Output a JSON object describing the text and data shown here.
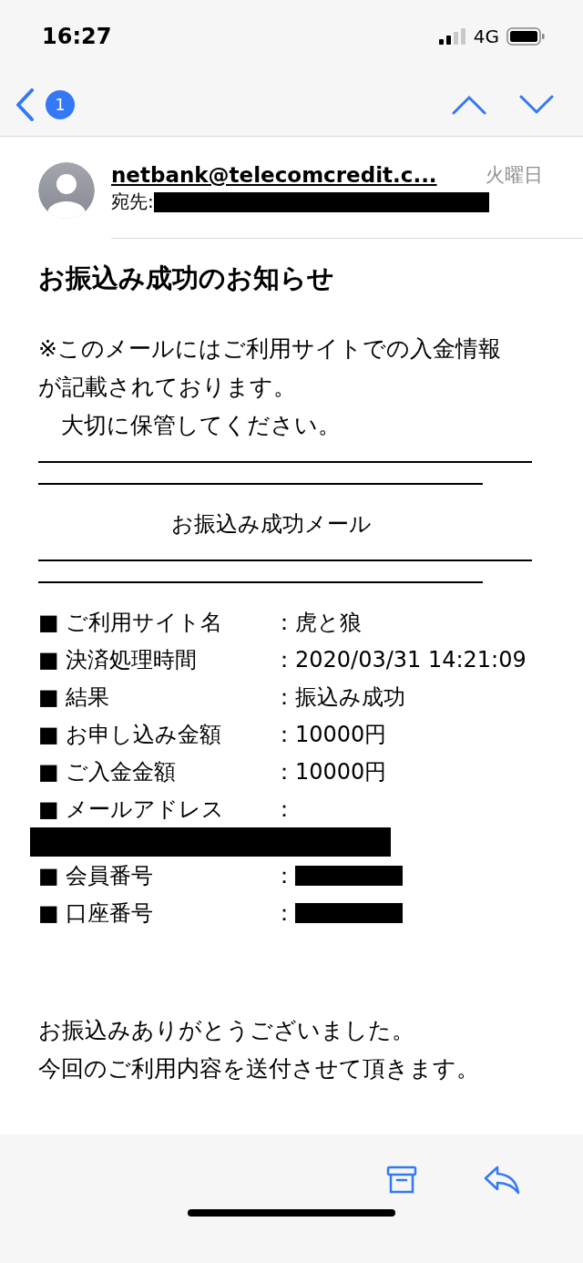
{
  "status_bar": {
    "time": "16:27",
    "network": "4G"
  },
  "nav": {
    "unread_count": "1"
  },
  "header": {
    "sender": "netbank@telecomcredit.c...",
    "date": "火曜日",
    "to_label": "宛先:"
  },
  "message": {
    "title": "お振込み成功のお知らせ",
    "intro_lines": [
      "※このメールにはご利用サイトでの入金情報",
      "が記載されております。",
      "　大切に保管してください。"
    ],
    "banner": "お振込み成功メール",
    "rows": [
      {
        "label": "■ ご利用サイト名",
        "value": "：虎と狼",
        "kind": "plain"
      },
      {
        "label": "■ 決済処理時間",
        "value": "：2020/03/31 14:21:09",
        "kind": "plain"
      },
      {
        "label": "■ 結果",
        "value": "：振込み成功",
        "kind": "plain"
      },
      {
        "label": "■ お申し込み金額",
        "value": "：10000円",
        "kind": "plain"
      },
      {
        "label": "■ ご入金金額",
        "value": "：10000円",
        "kind": "plain"
      },
      {
        "label": "■ メールアドレス",
        "value": "：",
        "kind": "redacted_below"
      },
      {
        "label": "■ 会員番号",
        "value": "：",
        "kind": "redacted_inline"
      },
      {
        "label": "■ 口座番号",
        "value": "：",
        "kind": "redacted_inline"
      }
    ],
    "closing_lines": [
      "お振込みありがとうございました。",
      "今回のご利用内容を送付させて頂きます。"
    ]
  }
}
